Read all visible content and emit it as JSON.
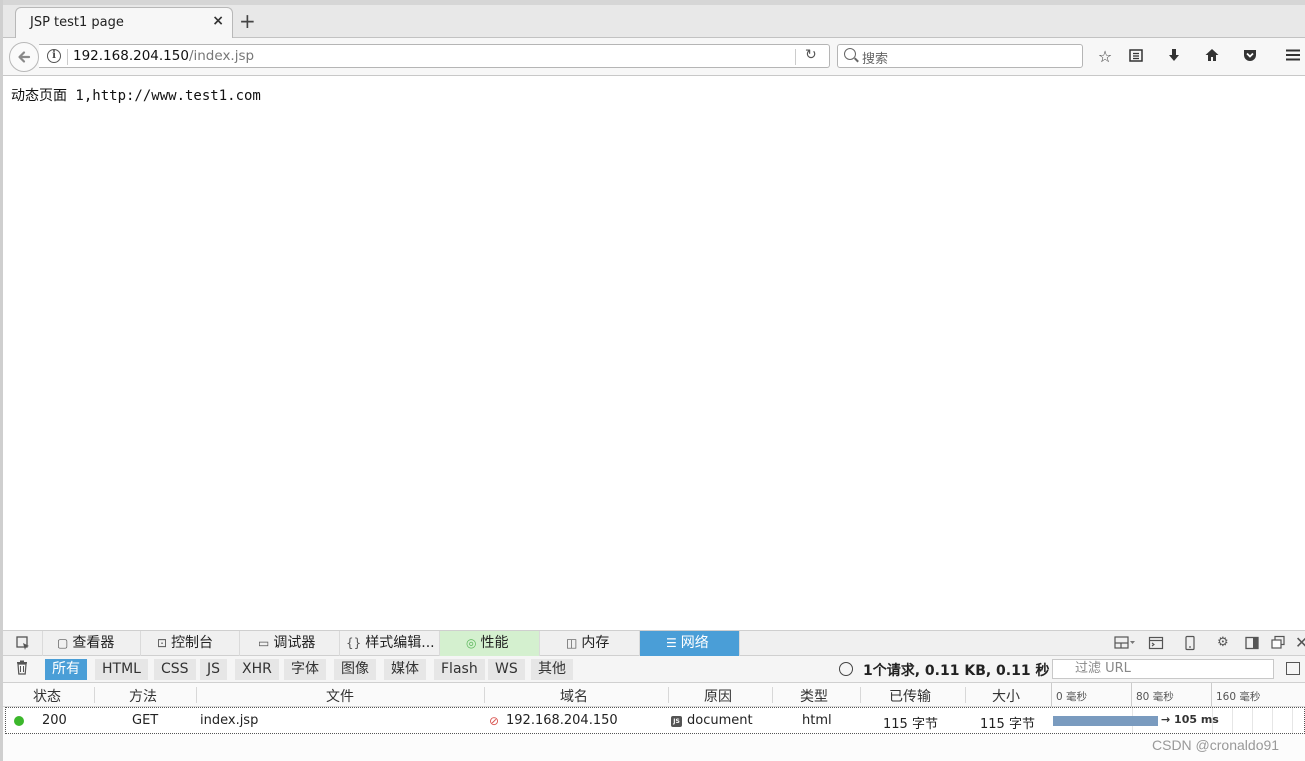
{
  "browser": {
    "tab": {
      "title": "JSP test1 page",
      "close_glyph": "×"
    },
    "new_tab_glyph": "+",
    "url": {
      "host": "192.168.204.150",
      "path": "/index.jsp"
    },
    "search": {
      "placeholder": "搜索"
    }
  },
  "page": {
    "text": "动态页面 1,http://www.test1.com"
  },
  "devtools": {
    "tabs": [
      {
        "label": "查看器",
        "icon": "inspector-icon"
      },
      {
        "label": "控制台",
        "icon": "console-icon"
      },
      {
        "label": "调试器",
        "icon": "debugger-icon"
      },
      {
        "label": "样式编辑...",
        "icon": "style-editor-icon"
      },
      {
        "label": "性能",
        "icon": "performance-icon"
      },
      {
        "label": "内存",
        "icon": "memory-icon"
      },
      {
        "label": "网络",
        "icon": "network-icon",
        "active": true
      }
    ],
    "filters": [
      "所有",
      "HTML",
      "CSS",
      "JS",
      "XHR",
      "字体",
      "图像",
      "媒体",
      "Flash",
      "WS",
      "其他"
    ],
    "active_filter": "所有",
    "summary": "1个请求, 0.11 KB, 0.11 秒",
    "filter_url_placeholder": "过滤 URL",
    "columns": {
      "status": "状态",
      "method": "方法",
      "file": "文件",
      "domain": "域名",
      "cause": "原因",
      "type": "类型",
      "transferred": "已传输",
      "size": "大小"
    },
    "timeline_ticks": [
      "0 毫秒",
      "80 毫秒",
      "160 毫秒"
    ],
    "request": {
      "status": "200",
      "method": "GET",
      "file": "index.jsp",
      "domain": "192.168.204.150",
      "cause": "document",
      "type": "html",
      "transferred": "115 字节",
      "size": "115 字节",
      "timing": "→ 105 ms"
    },
    "colors": {
      "active_tab": "#4a9ed7",
      "perf_tab": "#d4f0cf",
      "status_ok": "#3cb72c"
    }
  },
  "watermark": "CSDN @cronaldo91"
}
